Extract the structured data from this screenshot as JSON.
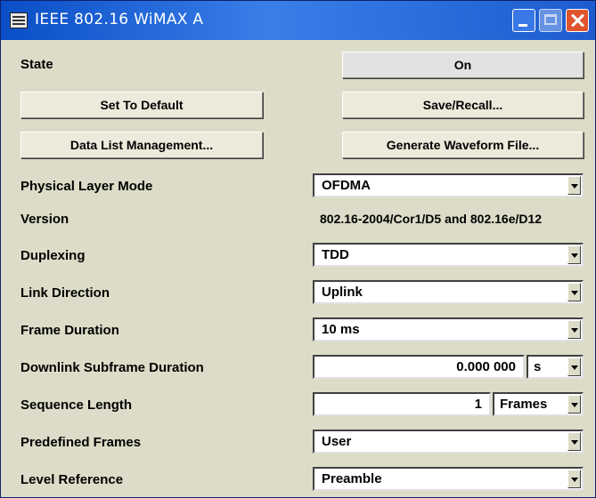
{
  "window": {
    "title": "IEEE 802.16 WiMAX A"
  },
  "state": {
    "label": "State",
    "button": "On"
  },
  "buttons": {
    "set_default": "Set To Default",
    "save_recall": "Save/Recall...",
    "data_list": "Data List Management...",
    "generate": "Generate Waveform File..."
  },
  "rows": {
    "physical_layer_mode": {
      "label": "Physical Layer Mode",
      "value": "OFDMA"
    },
    "version": {
      "label": "Version",
      "value": "802.16-2004/Cor1/D5 and 802.16e/D12"
    },
    "duplexing": {
      "label": "Duplexing",
      "value": "TDD"
    },
    "link_direction": {
      "label": "Link Direction",
      "value": "Uplink"
    },
    "frame_duration": {
      "label": "Frame Duration",
      "value": "10 ms"
    },
    "downlink_subframe": {
      "label": "Downlink Subframe Duration",
      "value": "0.000 000",
      "unit": "s"
    },
    "sequence_length": {
      "label": "Sequence Length",
      "value": "1",
      "unit": "Frames"
    },
    "predefined_frames": {
      "label": "Predefined Frames",
      "value": "User"
    },
    "level_reference": {
      "label": "Level Reference",
      "value": "Preamble"
    }
  }
}
